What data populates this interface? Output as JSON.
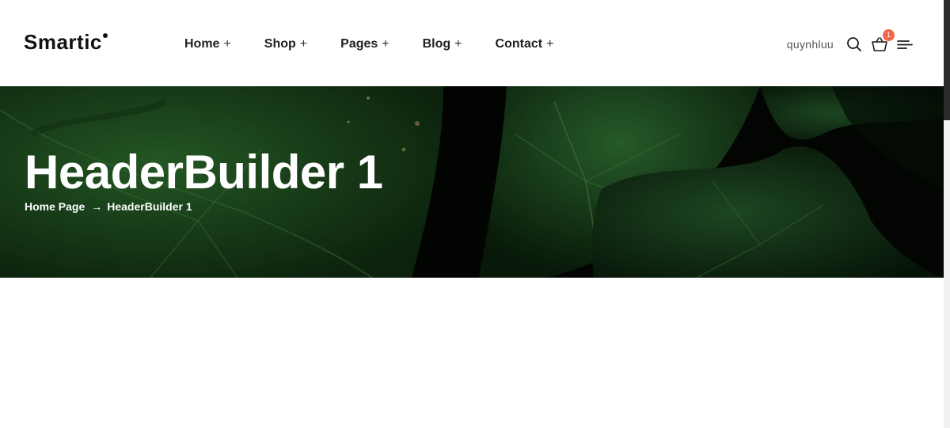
{
  "header": {
    "logo": "Smartic",
    "nav": [
      {
        "label": "Home",
        "suffix": "+"
      },
      {
        "label": "Shop",
        "suffix": "+"
      },
      {
        "label": "Pages",
        "suffix": "+"
      },
      {
        "label": "Blog",
        "suffix": "+"
      },
      {
        "label": "Contact",
        "suffix": "+"
      }
    ],
    "account": "quynhluu",
    "cart_count": "1",
    "icons": [
      "search-icon",
      "basket-icon",
      "menu-icon"
    ]
  },
  "hero": {
    "title": "HeaderBuilder 1",
    "breadcrumb": {
      "home": "Home Page",
      "separator": "→",
      "current": "HeaderBuilder 1"
    }
  },
  "colors": {
    "badge": "#f0684a",
    "hero_background": "#040704",
    "leaf_green": "#1d4a1f"
  }
}
